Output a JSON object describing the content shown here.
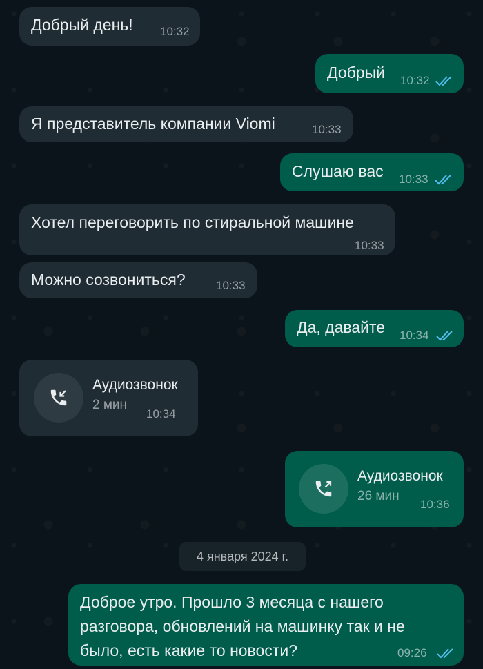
{
  "chat": {
    "messages": [
      {
        "text": "Добрый день!",
        "time": "10:32"
      },
      {
        "text": "Добрый",
        "time": "10:32"
      },
      {
        "text": "Я представитель компании Viomi",
        "time": "10:33"
      },
      {
        "text": "Слушаю вас",
        "time": "10:33"
      },
      {
        "text": "Хотел переговорить по стиральной машине",
        "time": "10:33"
      },
      {
        "text": "Можно созвониться?",
        "time": "10:33"
      },
      {
        "text": "Да, давайте",
        "time": "10:34"
      },
      {
        "text": "Доброе утро. Прошло 3 месяца с нашего разговора, обновлений на машинку так и не было, есть какие то новости?",
        "time": "09:26"
      }
    ],
    "calls": [
      {
        "title": "Аудиозвонок",
        "duration": "2 мин",
        "time": "10:34",
        "icon": "incoming-call-icon"
      },
      {
        "title": "Аудиозвонок",
        "duration": "26 мин",
        "time": "10:36",
        "icon": "outgoing-call-icon"
      }
    ],
    "date_separator": "4 января 2024 г.",
    "colors": {
      "incoming_bubble": "#202c33",
      "outgoing_bubble": "#005c4b",
      "read_ticks": "#53bdeb",
      "background": "#0b141a"
    }
  }
}
